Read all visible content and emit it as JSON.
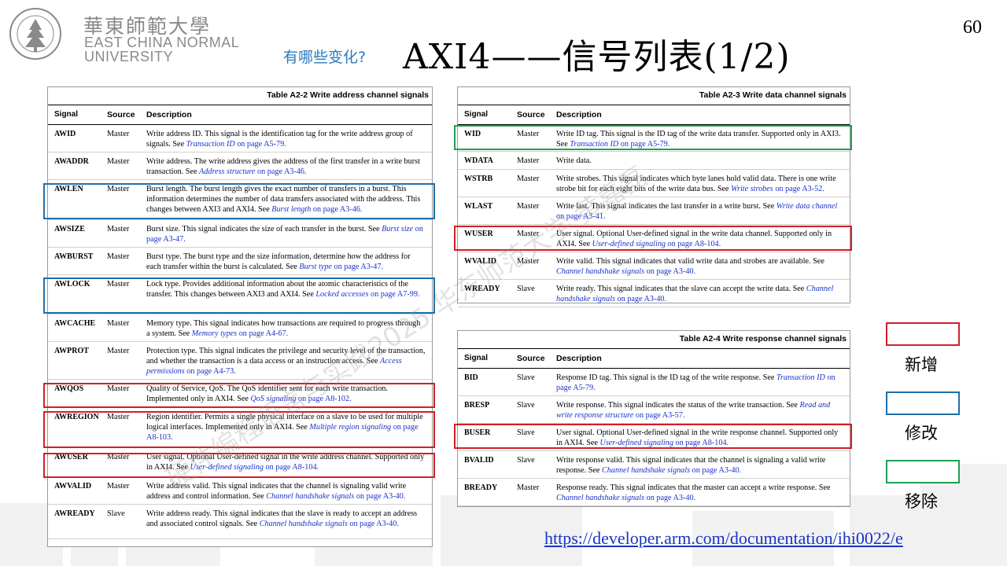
{
  "header": {
    "university_cn": "華東師範大學",
    "university_en_line1": "EAST CHINA NORMAL",
    "university_en_line2": "UNIVERSITY",
    "seal_text_top": "EAST CHINA NORMAL UNIVERSITY",
    "seal_text_bottom": "華東師範大學",
    "page_number": "60",
    "subtitle": "有哪些变化?",
    "title": "AXI4——信号列表(1/2)"
  },
  "watermark": "硬件编程语言与实践2025 华东师范大学 黄嘉磊",
  "headers": {
    "signal": "Signal",
    "source": "Source",
    "description": "Description"
  },
  "table_a22": {
    "caption": "Table A2-2 Write address channel signals",
    "rows": [
      {
        "signal": "AWID",
        "source": "Master",
        "desc": "Write address ID. This signal is the identification tag for the write address group of signals. See ",
        "link": "Transaction ID",
        "ref": " on page A5-79."
      },
      {
        "signal": "AWADDR",
        "source": "Master",
        "desc": "Write address. The write address gives the address of the first transfer in a write burst transaction. See ",
        "link": "Address structure",
        "ref": " on page A3-46."
      },
      {
        "signal": "AWLEN",
        "source": "Master",
        "desc": "Burst length. The burst length gives the exact number of transfers in a burst. This information determines the number of data transfers associated with the address. This changes between AXI3 and AXI4. See ",
        "link": "Burst length",
        "ref": " on page A3-46."
      },
      {
        "signal": "AWSIZE",
        "source": "Master",
        "desc": "Burst size. This signal indicates the size of each transfer in the burst. See ",
        "link": "Burst size",
        "ref": " on page A3-47."
      },
      {
        "signal": "AWBURST",
        "source": "Master",
        "desc": "Burst type. The burst type and the size information, determine how the address for each transfer within the burst is calculated. See ",
        "link": "Burst type",
        "ref": " on page A3-47."
      },
      {
        "signal": "AWLOCK",
        "source": "Master",
        "desc": "Lock type. Provides additional information about the atomic characteristics of the transfer. This changes between AXI3 and AXI4. See ",
        "link": "Locked accesses",
        "ref": " on page A7-99."
      },
      {
        "signal": "AWCACHE",
        "source": "Master",
        "desc": "Memory type. This signal indicates how transactions are required to progress through a system. See ",
        "link": "Memory types",
        "ref": " on page A4-67."
      },
      {
        "signal": "AWPROT",
        "source": "Master",
        "desc": "Protection type. This signal indicates the privilege and security level of the transaction, and whether the transaction is a data access or an instruction access. See ",
        "link": "Access permissions",
        "ref": " on page A4-73."
      },
      {
        "signal": "AWQOS",
        "source": "Master",
        "desc": "Quality of Service, QoS. The QoS identifier sent for each write transaction. Implemented only in AXI4. See ",
        "link": "QoS signaling",
        "ref": " on page A8-102."
      },
      {
        "signal": "AWREGION",
        "source": "Master",
        "desc": "Region identifier. Permits a single physical interface on a slave to be used for multiple logical interfaces. Implemented only in AXI4. See ",
        "link": "Multiple region signaling",
        "ref": " on page A8-103."
      },
      {
        "signal": "AWUSER",
        "source": "Master",
        "desc": "User signal. Optional User-defined signal in the write address channel. Supported only in AXI4. See ",
        "link": "User-defined signaling",
        "ref": " on page A8-104."
      },
      {
        "signal": "AWVALID",
        "source": "Master",
        "desc": "Write address valid. This signal indicates that the channel is signaling valid write address and control information. See ",
        "link": "Channel handshake signals",
        "ref": " on page A3-40."
      },
      {
        "signal": "AWREADY",
        "source": "Slave",
        "desc": "Write address ready. This signal indicates that the slave is ready to accept an address and associated control signals. See ",
        "link": "Channel handshake signals",
        "ref": " on page A3-40."
      }
    ]
  },
  "table_a23": {
    "caption": "Table A2-3 Write data channel signals",
    "rows": [
      {
        "signal": "WID",
        "source": "Master",
        "desc": "Write ID tag. This signal is the ID tag of the write data transfer. Supported only in AXI3. See ",
        "link": "Transaction ID",
        "ref": " on page A5-79."
      },
      {
        "signal": "WDATA",
        "source": "Master",
        "desc": "Write data.",
        "link": "",
        "ref": ""
      },
      {
        "signal": "WSTRB",
        "source": "Master",
        "desc": "Write strobes. This signal indicates which byte lanes hold valid data. There is one write strobe bit for each eight bits of the write data bus. See ",
        "link": "Write strobes",
        "ref": " on page A3-52."
      },
      {
        "signal": "WLAST",
        "source": "Master",
        "desc": "Write last. This signal indicates the last transfer in a write burst. See ",
        "link": "Write data channel",
        "ref": " on page A3-41."
      },
      {
        "signal": "WUSER",
        "source": "Master",
        "desc": "User signal. Optional User-defined signal in the write data channel. Supported only in AXI4. See ",
        "link": "User-defined signaling",
        "ref": " on page A8-104."
      },
      {
        "signal": "WVALID",
        "source": "Master",
        "desc": "Write valid. This signal indicates that valid write data and strobes are available. See ",
        "link": "Channel handshake signals",
        "ref": " on page A3-40."
      },
      {
        "signal": "WREADY",
        "source": "Slave",
        "desc": "Write ready. This signal indicates that the slave can accept the write data. See ",
        "link": "Channel handshake signals",
        "ref": " on page A3-40."
      }
    ]
  },
  "table_a24": {
    "caption": "Table A2-4 Write response channel signals",
    "rows": [
      {
        "signal": "BID",
        "source": "Slave",
        "desc": "Response ID tag. This signal is the ID tag of the write response. See ",
        "link": "Transaction ID",
        "ref": " on page A5-79."
      },
      {
        "signal": "BRESP",
        "source": "Slave",
        "desc": "Write response. This signal indicates the status of the write transaction. See ",
        "link": "Read and write response structure",
        "ref": " on page A3-57."
      },
      {
        "signal": "BUSER",
        "source": "Slave",
        "desc": "User signal. Optional User-defined signal in the write response channel. Supported only in AXI4. See ",
        "link": "User-defined signaling",
        "ref": " on page A8-104."
      },
      {
        "signal": "BVALID",
        "source": "Slave",
        "desc": "Write response valid. This signal indicates that the channel is signaling a valid write response. See ",
        "link": "Channel handshake signals",
        "ref": " on page A3-40."
      },
      {
        "signal": "BREADY",
        "source": "Master",
        "desc": "Response ready. This signal indicates that the master can accept a write response. See ",
        "link": "Channel handshake signals",
        "ref": " on page A3-40."
      }
    ]
  },
  "legend": {
    "added": "新增",
    "modified": "修改",
    "removed": "移除"
  },
  "colors": {
    "added": "#d21e26",
    "modified": "#1f6fa8",
    "removed": "#20a050",
    "link": "#1a33c8",
    "subtitle": "#2a7abf"
  },
  "url": "https://developer.arm.com/documentation/ihi0022/e"
}
